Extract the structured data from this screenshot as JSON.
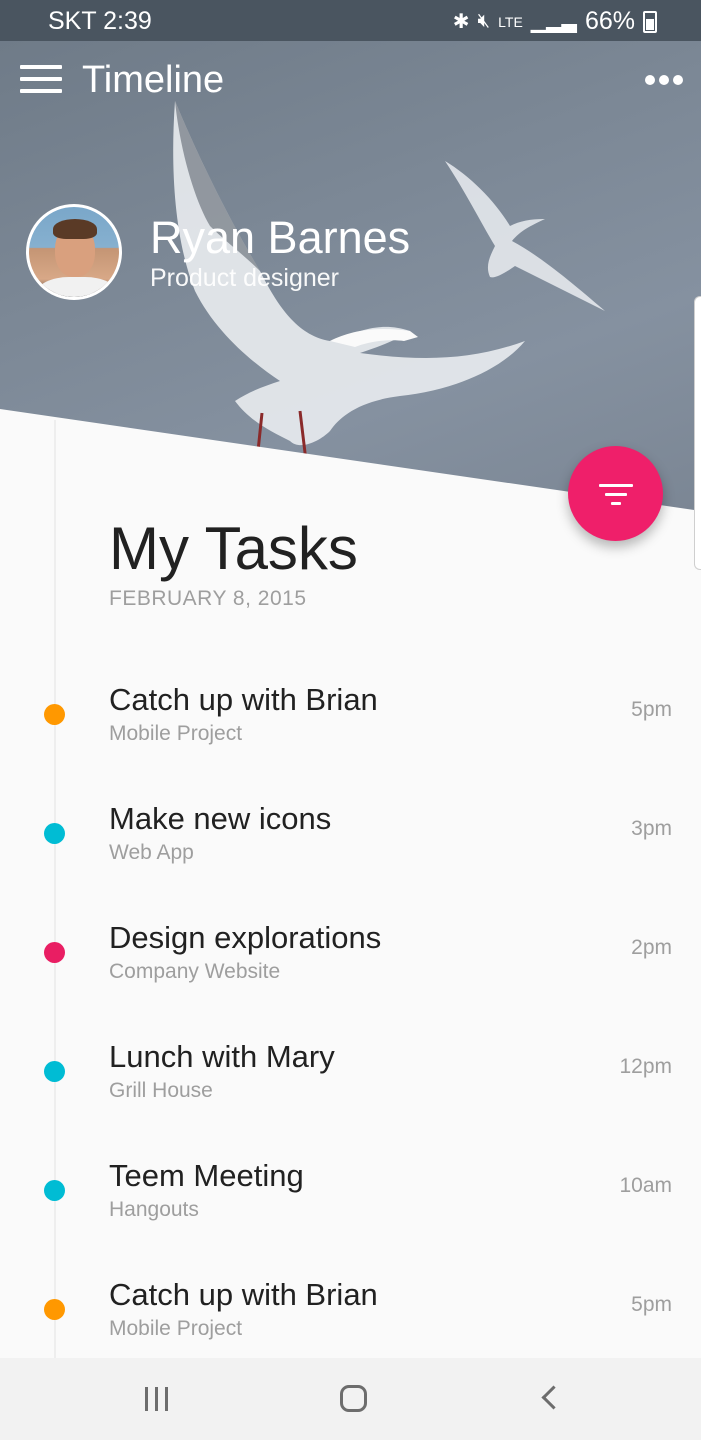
{
  "status_bar": {
    "carrier_time": "SKT 2:39",
    "network": "LTE",
    "battery": "66%"
  },
  "toolbar": {
    "title": "Timeline"
  },
  "profile": {
    "name": "Ryan Barnes",
    "role": "Product designer"
  },
  "tasks_header": {
    "title": "My Tasks",
    "date": "FEBRUARY 8, 2015"
  },
  "tasks": [
    {
      "title": "Catch up with Brian",
      "subtitle": "Mobile Project",
      "time": "5pm",
      "color": "#ff9800"
    },
    {
      "title": "Make new icons",
      "subtitle": "Web App",
      "time": "3pm",
      "color": "#00bcd4"
    },
    {
      "title": "Design explorations",
      "subtitle": "Company Website",
      "time": "2pm",
      "color": "#e91e63"
    },
    {
      "title": "Lunch with Mary",
      "subtitle": "Grill House",
      "time": "12pm",
      "color": "#00bcd4"
    },
    {
      "title": "Teem Meeting",
      "subtitle": "Hangouts",
      "time": "10am",
      "color": "#00bcd4"
    },
    {
      "title": "Catch up with Brian",
      "subtitle": "Mobile Project",
      "time": "5pm",
      "color": "#ff9800"
    }
  ],
  "colors": {
    "fab": "#ef1f6a",
    "accent_orange": "#ff9800",
    "accent_cyan": "#00bcd4",
    "accent_pink": "#e91e63"
  },
  "icons": {
    "menu": "hamburger-menu-icon",
    "more": "more-horizontal-icon",
    "fab": "filter-icon",
    "bluetooth": "bluetooth-icon",
    "mute": "mute-icon",
    "signal": "signal-icon",
    "battery": "battery-icon"
  }
}
